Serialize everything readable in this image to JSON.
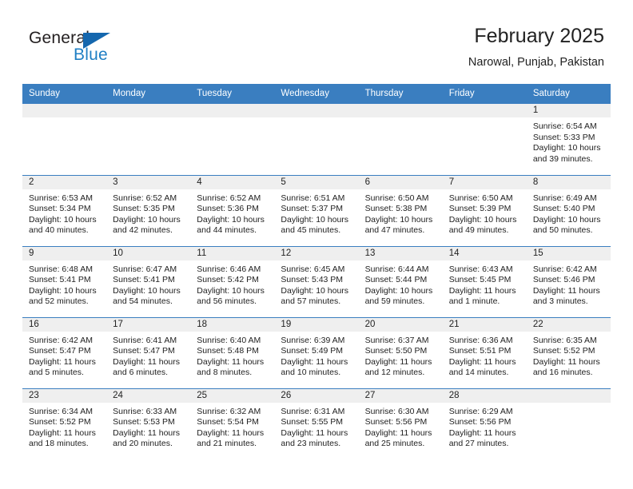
{
  "brand": {
    "name_part1": "General",
    "name_part2": "Blue",
    "accent_color": "#1567ae",
    "text_color": "#231f20"
  },
  "header": {
    "title": "February 2025",
    "location": "Narowal, Punjab, Pakistan"
  },
  "theme": {
    "header_row_bg": "#3a7ec0",
    "daynum_band_bg": "#efefef",
    "grid_line": "#3a7ec0",
    "text": "#222222"
  },
  "columns": [
    "Sunday",
    "Monday",
    "Tuesday",
    "Wednesday",
    "Thursday",
    "Friday",
    "Saturday"
  ],
  "weeks": [
    [
      {
        "day": "",
        "empty": true
      },
      {
        "day": "",
        "empty": true
      },
      {
        "day": "",
        "empty": true
      },
      {
        "day": "",
        "empty": true
      },
      {
        "day": "",
        "empty": true
      },
      {
        "day": "",
        "empty": true
      },
      {
        "day": "1",
        "sunrise": "Sunrise: 6:54 AM",
        "sunset": "Sunset: 5:33 PM",
        "daylight1": "Daylight: 10 hours",
        "daylight2": "and 39 minutes."
      }
    ],
    [
      {
        "day": "2",
        "sunrise": "Sunrise: 6:53 AM",
        "sunset": "Sunset: 5:34 PM",
        "daylight1": "Daylight: 10 hours",
        "daylight2": "and 40 minutes."
      },
      {
        "day": "3",
        "sunrise": "Sunrise: 6:52 AM",
        "sunset": "Sunset: 5:35 PM",
        "daylight1": "Daylight: 10 hours",
        "daylight2": "and 42 minutes."
      },
      {
        "day": "4",
        "sunrise": "Sunrise: 6:52 AM",
        "sunset": "Sunset: 5:36 PM",
        "daylight1": "Daylight: 10 hours",
        "daylight2": "and 44 minutes."
      },
      {
        "day": "5",
        "sunrise": "Sunrise: 6:51 AM",
        "sunset": "Sunset: 5:37 PM",
        "daylight1": "Daylight: 10 hours",
        "daylight2": "and 45 minutes."
      },
      {
        "day": "6",
        "sunrise": "Sunrise: 6:50 AM",
        "sunset": "Sunset: 5:38 PM",
        "daylight1": "Daylight: 10 hours",
        "daylight2": "and 47 minutes."
      },
      {
        "day": "7",
        "sunrise": "Sunrise: 6:50 AM",
        "sunset": "Sunset: 5:39 PM",
        "daylight1": "Daylight: 10 hours",
        "daylight2": "and 49 minutes."
      },
      {
        "day": "8",
        "sunrise": "Sunrise: 6:49 AM",
        "sunset": "Sunset: 5:40 PM",
        "daylight1": "Daylight: 10 hours",
        "daylight2": "and 50 minutes."
      }
    ],
    [
      {
        "day": "9",
        "sunrise": "Sunrise: 6:48 AM",
        "sunset": "Sunset: 5:41 PM",
        "daylight1": "Daylight: 10 hours",
        "daylight2": "and 52 minutes."
      },
      {
        "day": "10",
        "sunrise": "Sunrise: 6:47 AM",
        "sunset": "Sunset: 5:41 PM",
        "daylight1": "Daylight: 10 hours",
        "daylight2": "and 54 minutes."
      },
      {
        "day": "11",
        "sunrise": "Sunrise: 6:46 AM",
        "sunset": "Sunset: 5:42 PM",
        "daylight1": "Daylight: 10 hours",
        "daylight2": "and 56 minutes."
      },
      {
        "day": "12",
        "sunrise": "Sunrise: 6:45 AM",
        "sunset": "Sunset: 5:43 PM",
        "daylight1": "Daylight: 10 hours",
        "daylight2": "and 57 minutes."
      },
      {
        "day": "13",
        "sunrise": "Sunrise: 6:44 AM",
        "sunset": "Sunset: 5:44 PM",
        "daylight1": "Daylight: 10 hours",
        "daylight2": "and 59 minutes."
      },
      {
        "day": "14",
        "sunrise": "Sunrise: 6:43 AM",
        "sunset": "Sunset: 5:45 PM",
        "daylight1": "Daylight: 11 hours",
        "daylight2": "and 1 minute."
      },
      {
        "day": "15",
        "sunrise": "Sunrise: 6:42 AM",
        "sunset": "Sunset: 5:46 PM",
        "daylight1": "Daylight: 11 hours",
        "daylight2": "and 3 minutes."
      }
    ],
    [
      {
        "day": "16",
        "sunrise": "Sunrise: 6:42 AM",
        "sunset": "Sunset: 5:47 PM",
        "daylight1": "Daylight: 11 hours",
        "daylight2": "and 5 minutes."
      },
      {
        "day": "17",
        "sunrise": "Sunrise: 6:41 AM",
        "sunset": "Sunset: 5:47 PM",
        "daylight1": "Daylight: 11 hours",
        "daylight2": "and 6 minutes."
      },
      {
        "day": "18",
        "sunrise": "Sunrise: 6:40 AM",
        "sunset": "Sunset: 5:48 PM",
        "daylight1": "Daylight: 11 hours",
        "daylight2": "and 8 minutes."
      },
      {
        "day": "19",
        "sunrise": "Sunrise: 6:39 AM",
        "sunset": "Sunset: 5:49 PM",
        "daylight1": "Daylight: 11 hours",
        "daylight2": "and 10 minutes."
      },
      {
        "day": "20",
        "sunrise": "Sunrise: 6:37 AM",
        "sunset": "Sunset: 5:50 PM",
        "daylight1": "Daylight: 11 hours",
        "daylight2": "and 12 minutes."
      },
      {
        "day": "21",
        "sunrise": "Sunrise: 6:36 AM",
        "sunset": "Sunset: 5:51 PM",
        "daylight1": "Daylight: 11 hours",
        "daylight2": "and 14 minutes."
      },
      {
        "day": "22",
        "sunrise": "Sunrise: 6:35 AM",
        "sunset": "Sunset: 5:52 PM",
        "daylight1": "Daylight: 11 hours",
        "daylight2": "and 16 minutes."
      }
    ],
    [
      {
        "day": "23",
        "sunrise": "Sunrise: 6:34 AM",
        "sunset": "Sunset: 5:52 PM",
        "daylight1": "Daylight: 11 hours",
        "daylight2": "and 18 minutes."
      },
      {
        "day": "24",
        "sunrise": "Sunrise: 6:33 AM",
        "sunset": "Sunset: 5:53 PM",
        "daylight1": "Daylight: 11 hours",
        "daylight2": "and 20 minutes."
      },
      {
        "day": "25",
        "sunrise": "Sunrise: 6:32 AM",
        "sunset": "Sunset: 5:54 PM",
        "daylight1": "Daylight: 11 hours",
        "daylight2": "and 21 minutes."
      },
      {
        "day": "26",
        "sunrise": "Sunrise: 6:31 AM",
        "sunset": "Sunset: 5:55 PM",
        "daylight1": "Daylight: 11 hours",
        "daylight2": "and 23 minutes."
      },
      {
        "day": "27",
        "sunrise": "Sunrise: 6:30 AM",
        "sunset": "Sunset: 5:56 PM",
        "daylight1": "Daylight: 11 hours",
        "daylight2": "and 25 minutes."
      },
      {
        "day": "28",
        "sunrise": "Sunrise: 6:29 AM",
        "sunset": "Sunset: 5:56 PM",
        "daylight1": "Daylight: 11 hours",
        "daylight2": "and 27 minutes."
      },
      {
        "day": "",
        "empty": true
      }
    ]
  ]
}
